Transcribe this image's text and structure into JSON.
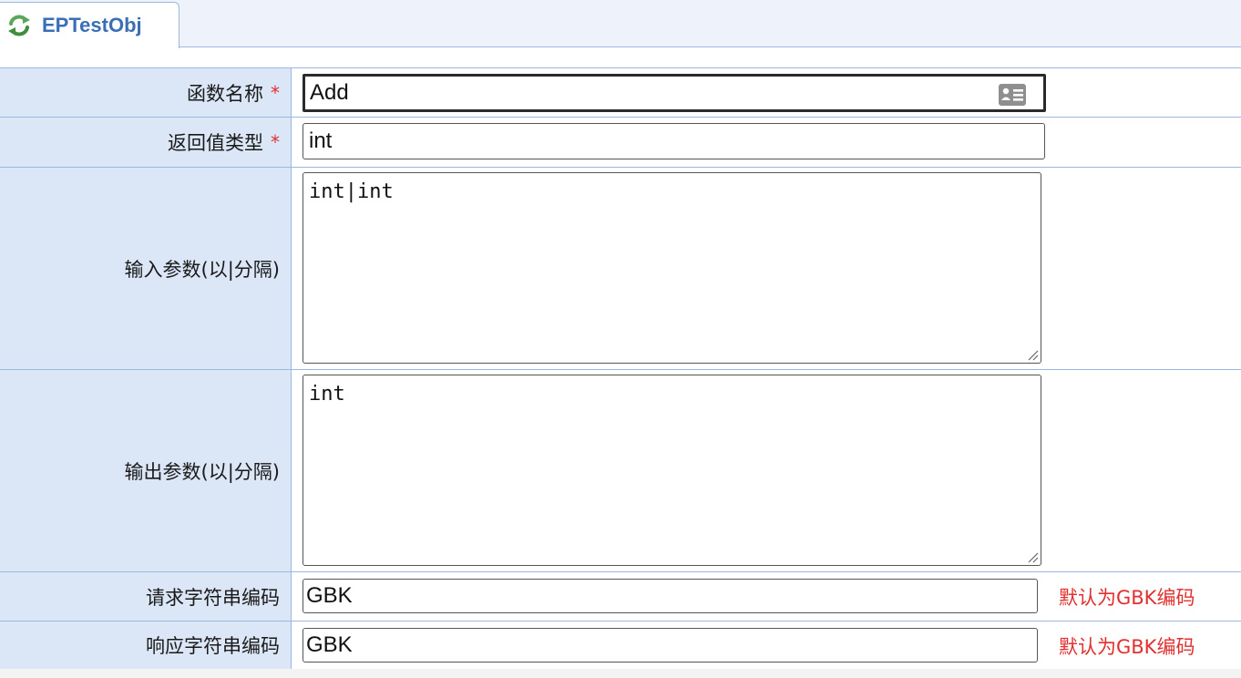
{
  "tab": {
    "title": "EPTestObj",
    "icon": "refresh-icon"
  },
  "form": {
    "function_name": {
      "label": "函数名称",
      "required_mark": "*",
      "value": "Add"
    },
    "return_type": {
      "label": "返回值类型",
      "required_mark": "*",
      "value": "int"
    },
    "input_params": {
      "label": "输入参数(以|分隔)",
      "value": "int|int"
    },
    "output_params": {
      "label": "输出参数(以|分隔)",
      "value": "int"
    },
    "request_encoding": {
      "label": "请求字符串编码",
      "value": "GBK",
      "hint": "默认为GBK编码"
    },
    "response_encoding": {
      "label": "响应字符串编码",
      "value": "GBK",
      "hint": "默认为GBK编码"
    }
  },
  "colors": {
    "label_bg": "#dbe6f6",
    "border": "#9db8e0",
    "required": "#e03030",
    "hint": "#e0302f",
    "tab_text": "#3a6fb5"
  }
}
